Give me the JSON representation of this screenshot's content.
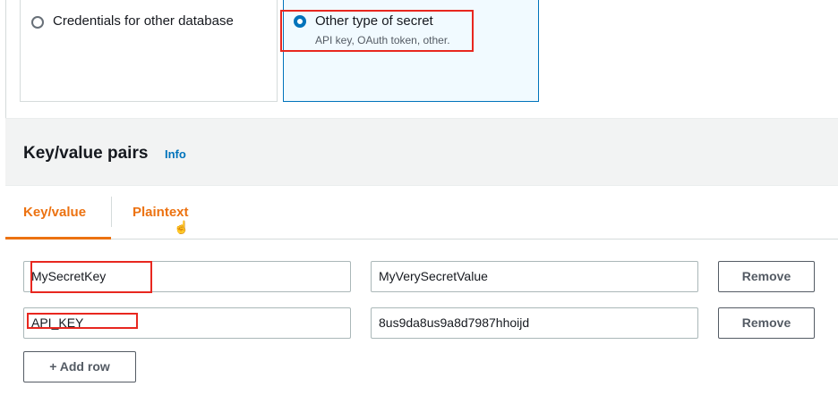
{
  "secret_type": {
    "option_db": {
      "label": "Credentials for other database"
    },
    "option_other": {
      "label": "Other type of secret",
      "description": "API key, OAuth token, other."
    }
  },
  "panel": {
    "title": "Key/value pairs",
    "info": "Info",
    "tabs": [
      {
        "label": "Key/value",
        "active": true
      },
      {
        "label": "Plaintext",
        "active": false
      }
    ],
    "rows": [
      {
        "key": "MySecretKey",
        "value": "MyVerySecretValue",
        "remove_label": "Remove"
      },
      {
        "key": "API_KEY",
        "value": "8us9da8us9a8d7987hhoijd",
        "remove_label": "Remove"
      }
    ],
    "add_row_label": "+ Add row"
  },
  "colors": {
    "accent": "#0073bb",
    "tab_active": "#ec7211",
    "highlight": "#e8271f"
  }
}
